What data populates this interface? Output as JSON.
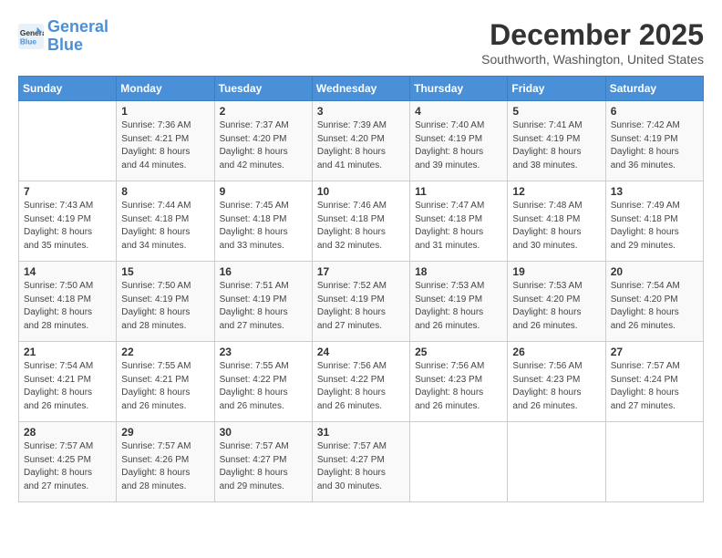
{
  "logo": {
    "line1": "General",
    "line2": "Blue"
  },
  "title": "December 2025",
  "subtitle": "Southworth, Washington, United States",
  "header": {
    "days": [
      "Sunday",
      "Monday",
      "Tuesday",
      "Wednesday",
      "Thursday",
      "Friday",
      "Saturday"
    ]
  },
  "weeks": [
    [
      {
        "day": "",
        "info": ""
      },
      {
        "day": "1",
        "info": "Sunrise: 7:36 AM\nSunset: 4:21 PM\nDaylight: 8 hours\nand 44 minutes."
      },
      {
        "day": "2",
        "info": "Sunrise: 7:37 AM\nSunset: 4:20 PM\nDaylight: 8 hours\nand 42 minutes."
      },
      {
        "day": "3",
        "info": "Sunrise: 7:39 AM\nSunset: 4:20 PM\nDaylight: 8 hours\nand 41 minutes."
      },
      {
        "day": "4",
        "info": "Sunrise: 7:40 AM\nSunset: 4:19 PM\nDaylight: 8 hours\nand 39 minutes."
      },
      {
        "day": "5",
        "info": "Sunrise: 7:41 AM\nSunset: 4:19 PM\nDaylight: 8 hours\nand 38 minutes."
      },
      {
        "day": "6",
        "info": "Sunrise: 7:42 AM\nSunset: 4:19 PM\nDaylight: 8 hours\nand 36 minutes."
      }
    ],
    [
      {
        "day": "7",
        "info": "Sunrise: 7:43 AM\nSunset: 4:19 PM\nDaylight: 8 hours\nand 35 minutes."
      },
      {
        "day": "8",
        "info": "Sunrise: 7:44 AM\nSunset: 4:18 PM\nDaylight: 8 hours\nand 34 minutes."
      },
      {
        "day": "9",
        "info": "Sunrise: 7:45 AM\nSunset: 4:18 PM\nDaylight: 8 hours\nand 33 minutes."
      },
      {
        "day": "10",
        "info": "Sunrise: 7:46 AM\nSunset: 4:18 PM\nDaylight: 8 hours\nand 32 minutes."
      },
      {
        "day": "11",
        "info": "Sunrise: 7:47 AM\nSunset: 4:18 PM\nDaylight: 8 hours\nand 31 minutes."
      },
      {
        "day": "12",
        "info": "Sunrise: 7:48 AM\nSunset: 4:18 PM\nDaylight: 8 hours\nand 30 minutes."
      },
      {
        "day": "13",
        "info": "Sunrise: 7:49 AM\nSunset: 4:18 PM\nDaylight: 8 hours\nand 29 minutes."
      }
    ],
    [
      {
        "day": "14",
        "info": "Sunrise: 7:50 AM\nSunset: 4:18 PM\nDaylight: 8 hours\nand 28 minutes."
      },
      {
        "day": "15",
        "info": "Sunrise: 7:50 AM\nSunset: 4:19 PM\nDaylight: 8 hours\nand 28 minutes."
      },
      {
        "day": "16",
        "info": "Sunrise: 7:51 AM\nSunset: 4:19 PM\nDaylight: 8 hours\nand 27 minutes."
      },
      {
        "day": "17",
        "info": "Sunrise: 7:52 AM\nSunset: 4:19 PM\nDaylight: 8 hours\nand 27 minutes."
      },
      {
        "day": "18",
        "info": "Sunrise: 7:53 AM\nSunset: 4:19 PM\nDaylight: 8 hours\nand 26 minutes."
      },
      {
        "day": "19",
        "info": "Sunrise: 7:53 AM\nSunset: 4:20 PM\nDaylight: 8 hours\nand 26 minutes."
      },
      {
        "day": "20",
        "info": "Sunrise: 7:54 AM\nSunset: 4:20 PM\nDaylight: 8 hours\nand 26 minutes."
      }
    ],
    [
      {
        "day": "21",
        "info": "Sunrise: 7:54 AM\nSunset: 4:21 PM\nDaylight: 8 hours\nand 26 minutes."
      },
      {
        "day": "22",
        "info": "Sunrise: 7:55 AM\nSunset: 4:21 PM\nDaylight: 8 hours\nand 26 minutes."
      },
      {
        "day": "23",
        "info": "Sunrise: 7:55 AM\nSunset: 4:22 PM\nDaylight: 8 hours\nand 26 minutes."
      },
      {
        "day": "24",
        "info": "Sunrise: 7:56 AM\nSunset: 4:22 PM\nDaylight: 8 hours\nand 26 minutes."
      },
      {
        "day": "25",
        "info": "Sunrise: 7:56 AM\nSunset: 4:23 PM\nDaylight: 8 hours\nand 26 minutes."
      },
      {
        "day": "26",
        "info": "Sunrise: 7:56 AM\nSunset: 4:23 PM\nDaylight: 8 hours\nand 26 minutes."
      },
      {
        "day": "27",
        "info": "Sunrise: 7:57 AM\nSunset: 4:24 PM\nDaylight: 8 hours\nand 27 minutes."
      }
    ],
    [
      {
        "day": "28",
        "info": "Sunrise: 7:57 AM\nSunset: 4:25 PM\nDaylight: 8 hours\nand 27 minutes."
      },
      {
        "day": "29",
        "info": "Sunrise: 7:57 AM\nSunset: 4:26 PM\nDaylight: 8 hours\nand 28 minutes."
      },
      {
        "day": "30",
        "info": "Sunrise: 7:57 AM\nSunset: 4:27 PM\nDaylight: 8 hours\nand 29 minutes."
      },
      {
        "day": "31",
        "info": "Sunrise: 7:57 AM\nSunset: 4:27 PM\nDaylight: 8 hours\nand 30 minutes."
      },
      {
        "day": "",
        "info": ""
      },
      {
        "day": "",
        "info": ""
      },
      {
        "day": "",
        "info": ""
      }
    ]
  ]
}
